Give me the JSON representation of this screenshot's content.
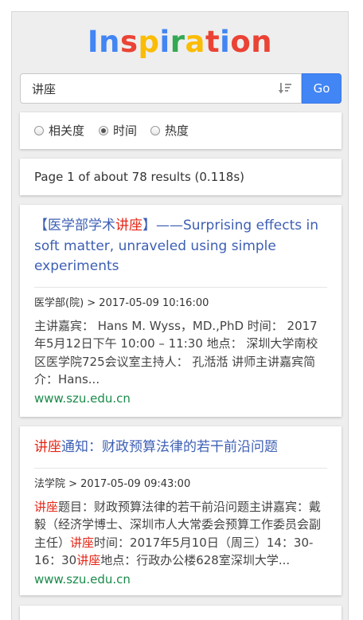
{
  "logo": {
    "letters": [
      {
        "ch": "I",
        "color": "#4285f4"
      },
      {
        "ch": "n",
        "color": "#4285f4"
      },
      {
        "ch": "s",
        "color": "#ea4335"
      },
      {
        "ch": "p",
        "color": "#fbbc05"
      },
      {
        "ch": "i",
        "color": "#4285f4"
      },
      {
        "ch": "r",
        "color": "#34a853"
      },
      {
        "ch": "a",
        "color": "#fbbc05"
      },
      {
        "ch": "t",
        "color": "#ea4335"
      },
      {
        "ch": "i",
        "color": "#4285f4"
      },
      {
        "ch": "o",
        "color": "#ea4335"
      },
      {
        "ch": "n",
        "color": "#ea4335"
      }
    ]
  },
  "search": {
    "value": "讲座",
    "sort_icon": "sort-descending-icon",
    "go_label": "Go"
  },
  "sort_options": [
    {
      "label": "相关度",
      "selected": false
    },
    {
      "label": "时间",
      "selected": true
    },
    {
      "label": "热度",
      "selected": false
    }
  ],
  "stats": {
    "text": "Page 1 of about 78 results (0.118s)"
  },
  "results": [
    {
      "title_parts": [
        {
          "t": "【医学部学术",
          "hl": false
        },
        {
          "t": "讲座",
          "hl": true
        },
        {
          "t": "】——Surprising effects in soft matter, unraveled using simple experiments",
          "hl": false
        }
      ],
      "meta": "医学部(院) > 2017-05-09 10:16:00",
      "snippet_parts": [
        {
          "t": "主讲嘉宾： Hans M. Wyss，MD.,PhD 时间： 2017年5月12日下午 10:00 – 11:30 地点： 深圳大学南校区医学院725会议室主持人： 孔湉湉 讲师主讲嘉宾简介：Hans...",
          "hl": false
        }
      ],
      "url": "www.szu.edu.cn"
    },
    {
      "title_parts": [
        {
          "t": "讲座",
          "hl": true
        },
        {
          "t": "通知：财政预算法律的若干前沿问题",
          "hl": false
        }
      ],
      "meta": "法学院 > 2017-05-09 09:43:00",
      "snippet_parts": [
        {
          "t": "讲座",
          "hl": true
        },
        {
          "t": "题目：财政预算法律的若干前沿问题主讲嘉宾：戴毅（经济学博士、深圳市人大常委会预算工作委员会副主任）",
          "hl": false
        },
        {
          "t": "讲座",
          "hl": true
        },
        {
          "t": "时间：2017年5月10日（周三）14：30-16：30",
          "hl": false
        },
        {
          "t": "讲座",
          "hl": true
        },
        {
          "t": "地点：行政办公楼628室深圳大学...",
          "hl": false
        }
      ],
      "url": "www.szu.edu.cn"
    }
  ]
}
